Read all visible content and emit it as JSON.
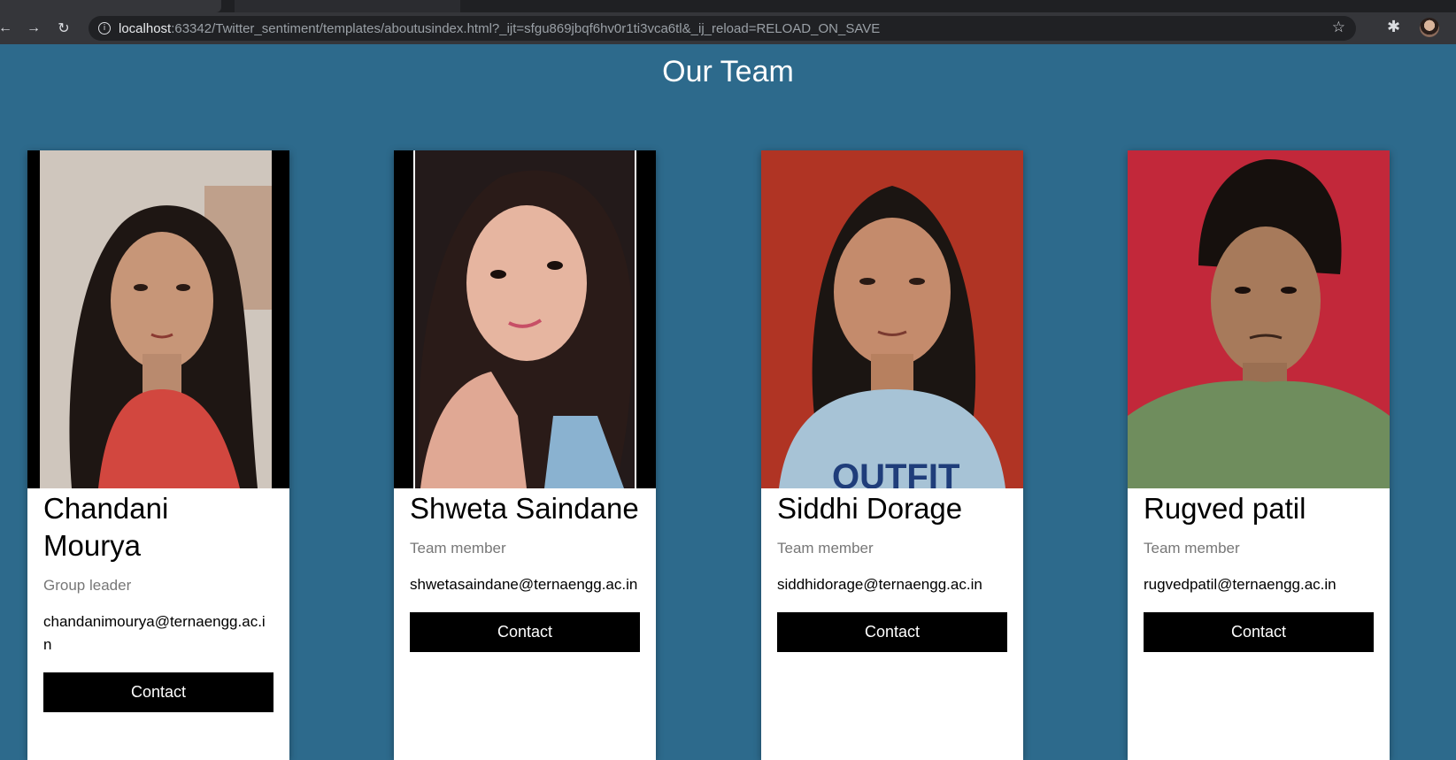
{
  "browser": {
    "url_host": "localhost",
    "url_rest": ":63342/Twitter_sentiment/templates/aboutusindex.html?_ijt=sfgu869jbqf6hv0r1ti3vca6tl&_ij_reload=RELOAD_ON_SAVE",
    "icons": [
      "back-arrow-icon",
      "forward-arrow-icon",
      "reload-icon",
      "info-icon",
      "star-icon",
      "extensions-icon",
      "profile-avatar-icon"
    ]
  },
  "page": {
    "title": "Our Team",
    "background_color": "#2d6a8c"
  },
  "team": [
    {
      "name": "Chandani Mourya",
      "role": "Group leader",
      "email": "chandanimourya@ternaengg.ac.in",
      "button": "Contact"
    },
    {
      "name": "Shweta Saindane",
      "role": "Team member",
      "email": "shwetasaindane@ternaengg.ac.in",
      "button": "Contact"
    },
    {
      "name": "Siddhi Dorage",
      "role": "Team member",
      "email": "siddhidorage@ternaengg.ac.in",
      "button": "Contact"
    },
    {
      "name": "Rugved patil",
      "role": "Team member",
      "email": "rugvedpatil@ternaengg.ac.in",
      "button": "Contact"
    }
  ]
}
